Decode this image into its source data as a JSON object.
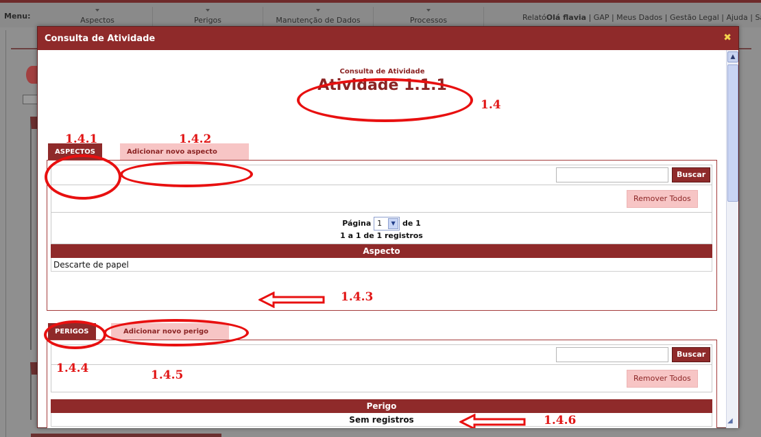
{
  "topbar": {
    "menu_label": "Menu:",
    "nav": [
      "Aspectos",
      "Perigos",
      "Manutenção de Dados",
      "Processos"
    ],
    "links_prefix": "Relató",
    "greeting": "Olá flavia",
    "links": "| GAP | Meus Dados | Gestão Legal | Ajuda | Sa"
  },
  "modal": {
    "title": "Consulta de Atividade",
    "close_symbol": "✖",
    "subtitle": "Consulta de Atividade",
    "heading": "Atividade 1.1.1"
  },
  "aspectos": {
    "tab_label": "ASPECTOS",
    "add_label": "Adicionar novo aspecto",
    "search_placeholder": "",
    "search_button": "Buscar",
    "remove_all": "Remover Todos",
    "page_label": "Página",
    "page_value": "1",
    "page_of": "de 1",
    "records": "1 a 1 de 1 registros",
    "column": "Aspecto",
    "rows": [
      "Descarte de papel"
    ]
  },
  "perigos": {
    "tab_label": "PERIGOS",
    "add_label": "Adicionar novo perigo",
    "search_placeholder": "",
    "search_button": "Buscar",
    "remove_all": "Remover Todos",
    "column": "Perigo",
    "empty": "Sem registros"
  },
  "annotations": {
    "a14": "1.4",
    "a141": "1.4.1",
    "a142": "1.4.2",
    "a143": "1.4.3",
    "a144": "1.4.4",
    "a145": "1.4.5",
    "a146": "1.4.6"
  },
  "colors": {
    "brand": "#8f2a2a",
    "tab_link_bg": "#f7c5c5",
    "annotation": "#e81010"
  }
}
